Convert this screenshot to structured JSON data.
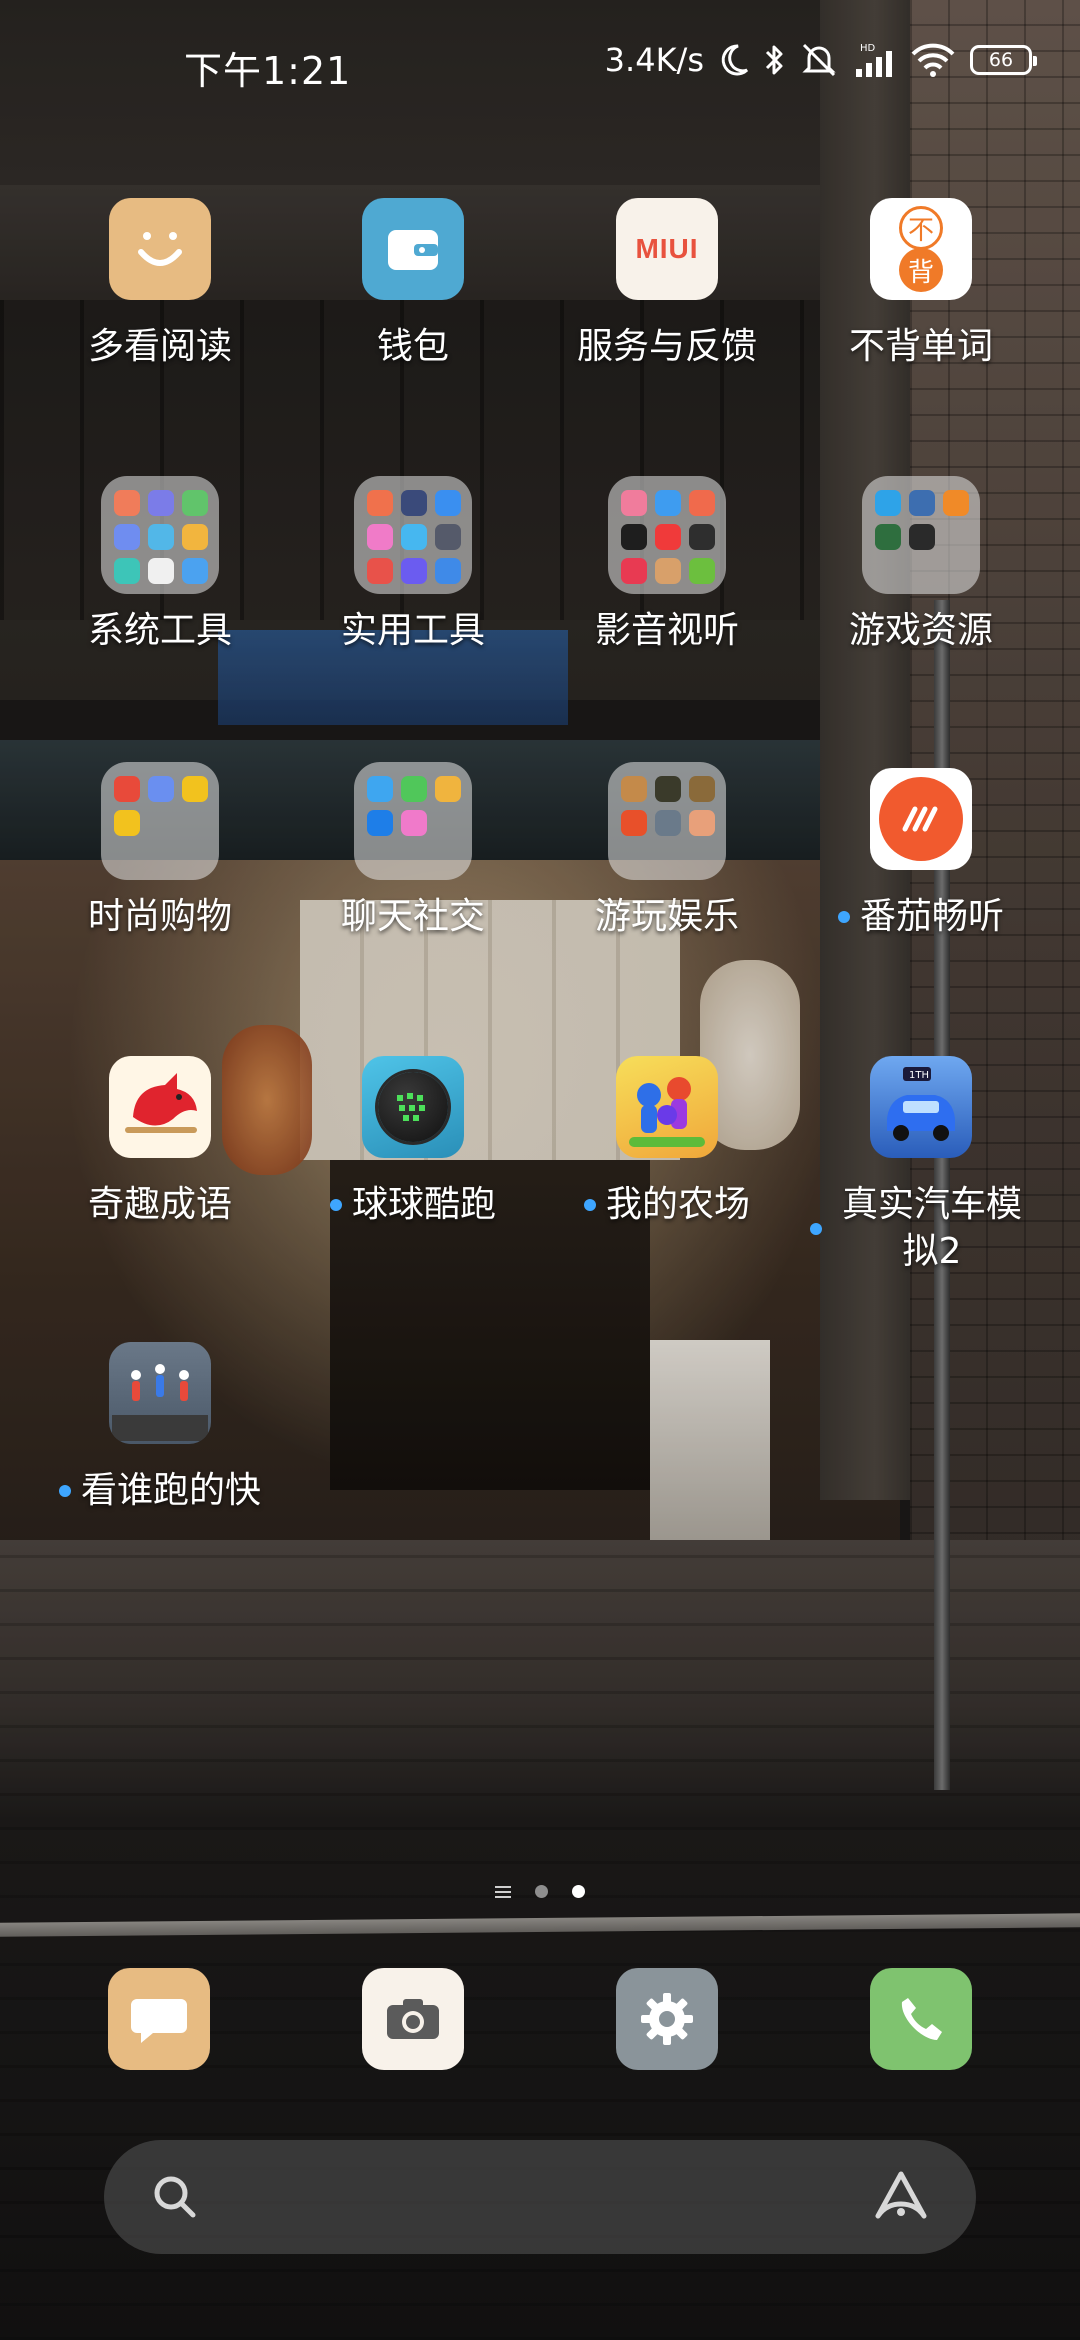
{
  "status_bar": {
    "time": "下午1:21",
    "network_speed": "3.4K/s",
    "icons": [
      "moon-icon",
      "bluetooth-icon",
      "mute-icon",
      "signal-hd-icon",
      "wifi-icon"
    ],
    "battery_level": "66"
  },
  "apps": [
    {
      "label": "多看阅读",
      "icon": "duokan-reading-icon",
      "color": "#E7BB82",
      "new": false
    },
    {
      "label": "钱包",
      "icon": "wallet-icon",
      "color": "#4FA9D2",
      "new": false
    },
    {
      "label": "服务与反馈",
      "icon": "miui-feedback-icon",
      "color": "#F8F2EA",
      "new": false
    },
    {
      "label": "不背单词",
      "icon": "bubei-words-icon",
      "color": "#FFFFFF",
      "new": false
    },
    {
      "label": "系统工具",
      "icon": "folder-icon",
      "folder": true,
      "new": false,
      "mini_colors": [
        "#F07C5A",
        "#7B7CE8",
        "#61C46B",
        "#6F8DF0",
        "#52B7E8",
        "#F2B53E",
        "#3DC5B8",
        "#F0F0F0",
        "#4BA2F0"
      ]
    },
    {
      "label": "实用工具",
      "icon": "folder-icon",
      "folder": true,
      "new": false,
      "mini_colors": [
        "#F0714C",
        "#3A4A7A",
        "#3A8FF0",
        "#F07BC8",
        "#46B7F0",
        "#555A6A",
        "#E8524A",
        "#6B5CF0",
        "#3F8AE8"
      ]
    },
    {
      "label": "影音视听",
      "icon": "folder-icon",
      "folder": true,
      "new": false,
      "mini_colors": [
        "#F07C9C",
        "#3E9CF0",
        "#F06A4C",
        "#1E1E1E",
        "#F03A3A",
        "#2E2E2E",
        "#E83A52",
        "#D8A06A",
        "#6CBF3E"
      ]
    },
    {
      "label": "游戏资源",
      "icon": "folder-icon",
      "folder": true,
      "new": false,
      "mini_colors": [
        "#2EA3E8",
        "#3D6EB0",
        "#F08A28",
        "#2E6E3E",
        "#2A2A2A"
      ]
    },
    {
      "label": "时尚购物",
      "icon": "folder-icon",
      "folder": true,
      "new": false,
      "mini_colors": [
        "#E84A3A",
        "#6A8FF0",
        "#F2C21E",
        "#F2C21E"
      ]
    },
    {
      "label": "聊天社交",
      "icon": "folder-icon",
      "folder": true,
      "new": false,
      "mini_colors": [
        "#3EA6F0",
        "#50C75A",
        "#F0B43E",
        "#1E7EE8",
        "#F07ACA"
      ]
    },
    {
      "label": "游玩娱乐",
      "icon": "folder-icon",
      "folder": true,
      "new": false,
      "mini_colors": [
        "#C48A4A",
        "#3A3A2A",
        "#8A6A3A",
        "#E8502A",
        "#6A7A8A",
        "#E8A07A"
      ]
    },
    {
      "label": "番茄畅听",
      "icon": "fanqie-listen-icon",
      "color": "#F15A2E",
      "new": true
    },
    {
      "label": "奇趣成语",
      "icon": "idiom-game-icon",
      "color": "#FFF6E6",
      "new": false
    },
    {
      "label": "球球酷跑",
      "icon": "ball-run-icon",
      "color": "#3AB0D8",
      "new": true
    },
    {
      "label": "我的农场",
      "icon": "my-farm-icon",
      "color": "#F2C94C",
      "new": true
    },
    {
      "label": "真实汽车模拟2",
      "icon": "car-sim-icon",
      "color": "#3D78E0",
      "new": true
    },
    {
      "label": "看谁跑的快",
      "icon": "who-runs-fast-icon",
      "color": "#5A6878",
      "new": true
    }
  ],
  "page_indicator": {
    "pages": 2,
    "active": 1
  },
  "dock": [
    {
      "name": "messages-icon",
      "color": "#E7BB82"
    },
    {
      "name": "camera-icon",
      "color": "#F8F2EA"
    },
    {
      "name": "settings-icon",
      "color": "#8A949A"
    },
    {
      "name": "phone-icon",
      "color": "#7FC36F"
    }
  ],
  "search": {
    "icon": "search-icon",
    "assistant_icon": "assistant-icon"
  }
}
